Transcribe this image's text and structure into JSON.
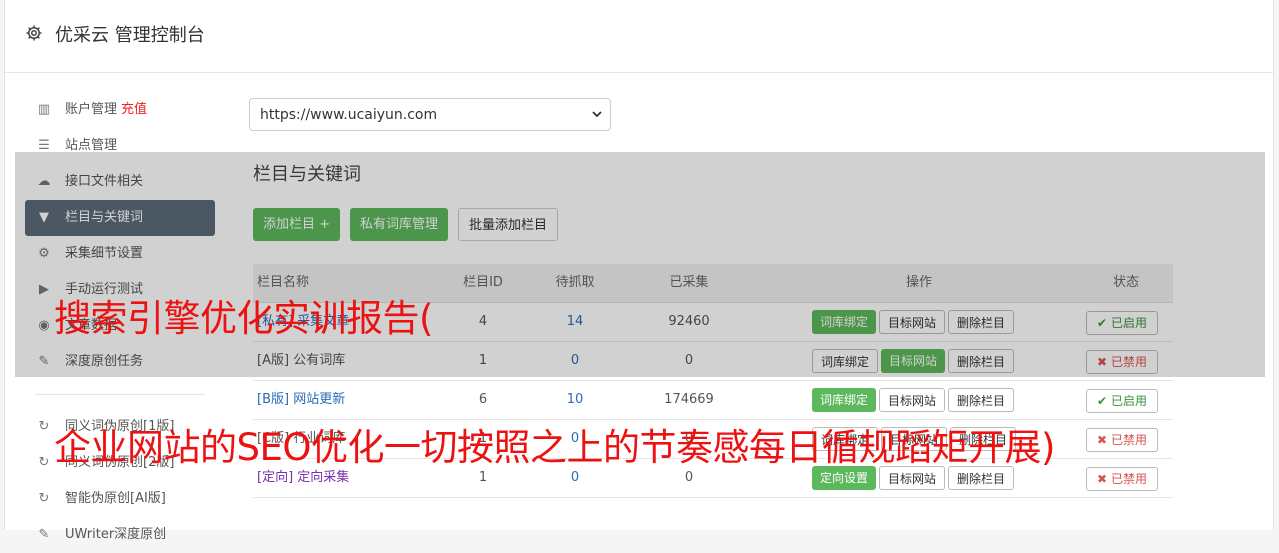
{
  "header": {
    "title": "优采云 管理控制台",
    "icon": "gear-icon"
  },
  "sidebar": {
    "items": [
      {
        "label": "账户管理",
        "badge": "充值",
        "icon": "bar-chart-icon"
      },
      {
        "label": "站点管理",
        "icon": "server-icon"
      },
      {
        "label": "接口文件相关",
        "icon": "cloud-upload-icon"
      },
      {
        "label": "栏目与关键词",
        "icon": "filter-icon",
        "active": true
      },
      {
        "label": "采集细节设置",
        "icon": "cogs-icon"
      },
      {
        "label": "手动运行测试",
        "icon": "play-circle-icon"
      },
      {
        "label": "文章数据",
        "icon": "database-icon"
      },
      {
        "label": "深度原创任务",
        "icon": "edit-icon"
      }
    ],
    "items2": [
      {
        "label": "同义词伪原创[1版]",
        "icon": "refresh-icon"
      },
      {
        "label": "同义词伪原创[2版]",
        "icon": "refresh-icon"
      },
      {
        "label": "智能伪原创[AI版]",
        "icon": "refresh-icon"
      },
      {
        "label": "UWriter深度原创",
        "icon": "edit-icon"
      }
    ]
  },
  "main": {
    "site_select": "https://www.ucaiyun.com",
    "section_title": "栏目与关键词",
    "buttons": {
      "add_column": "添加栏目 +",
      "private_lib": "私有词库管理",
      "batch_add": "批量添加栏目"
    },
    "table": {
      "headers": {
        "name": "栏目名称",
        "id": "栏目ID",
        "pending": "待抓取",
        "done": "已采集",
        "ops": "操作",
        "status": "状态"
      },
      "rows": [
        {
          "tag": "[私有]",
          "name": "采集文章",
          "id": "4",
          "pending": "14",
          "done": "92460",
          "op1": "词库绑定",
          "op2": "目标网站",
          "op3": "删除栏目",
          "status": "已启用"
        },
        {
          "tag": "[A版]",
          "name": "公有词库",
          "id": "1",
          "pending": "0",
          "done": "0",
          "op1": "词库绑定",
          "op2": "目标网站",
          "op3": "删除栏目",
          "status": "已禁用"
        },
        {
          "tag": "[B版]",
          "name": "网站更新",
          "id": "6",
          "pending": "10",
          "done": "174669",
          "op1": "词库绑定",
          "op2": "目标网站",
          "op3": "删除栏目",
          "status": "已启用"
        },
        {
          "tag": "[C版]",
          "name": "行业词库",
          "id": "1",
          "pending": "0",
          "done": "0",
          "op1": "词库绑定",
          "op2": "目标网站",
          "op3": "删除栏目",
          "status": "已禁用"
        },
        {
          "tag": "[定向]",
          "name": "定向采集",
          "id": "1",
          "pending": "0",
          "done": "0",
          "op1": "定向设置",
          "op2": "目标网站",
          "op3": "删除栏目",
          "status": "已禁用"
        }
      ]
    }
  },
  "overlay_text": {
    "line1": "搜索引擎优化实训报告(",
    "line2": "企业网站的SEO优化一切按照之上的节奏感每日循规蹈矩开展)"
  },
  "colors": {
    "green": "#5cb85c",
    "active_nav": "#5c6b78",
    "banner": "#ee1111"
  }
}
